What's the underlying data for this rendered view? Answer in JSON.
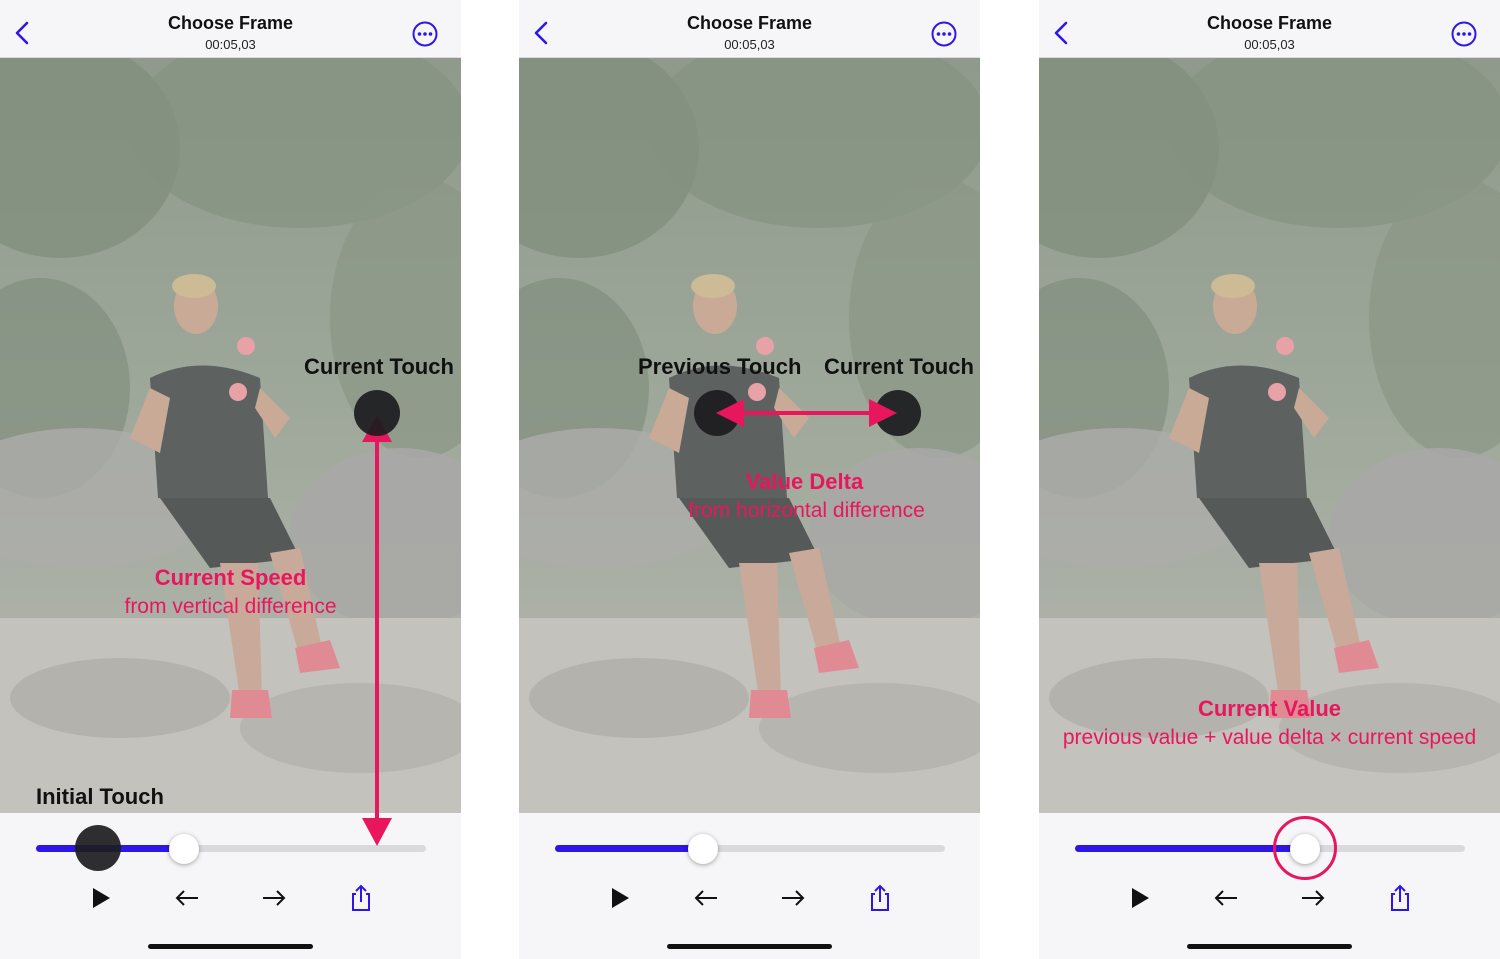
{
  "screens": [
    {
      "title": "Choose Frame",
      "timecode": "00:05,03",
      "slider_value": 0.38,
      "annotations": {
        "touch_top": "Current Touch",
        "touch_bottom": "Initial Touch",
        "explanation_title": "Current Speed",
        "explanation_sub": "from vertical difference"
      }
    },
    {
      "title": "Choose Frame",
      "timecode": "00:05,03",
      "slider_value": 0.38,
      "annotations": {
        "touch_left": "Previous Touch",
        "touch_right": "Current Touch",
        "explanation_title": "Value Delta",
        "explanation_sub": "from horizontal difference"
      }
    },
    {
      "title": "Choose Frame",
      "timecode": "00:05,03",
      "slider_value": 0.59,
      "annotations": {
        "explanation_title": "Current Value",
        "explanation_sub": "previous value + value delta  × current speed"
      }
    }
  ],
  "toolbar_icons": [
    "play-icon",
    "arrow-left-icon",
    "arrow-right-icon",
    "share-icon"
  ],
  "colors": {
    "accent": "#2e17e6",
    "annotation": "#e8175d",
    "touch": "#1c1c1e",
    "background": "#f6f6f8"
  }
}
